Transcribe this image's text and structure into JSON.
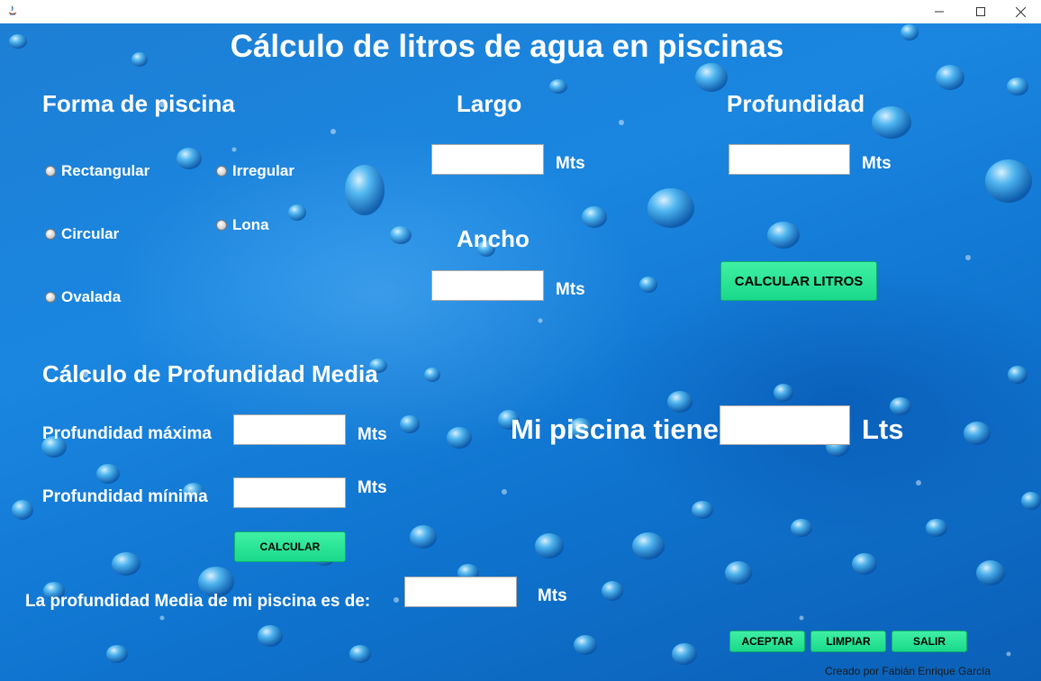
{
  "window": {
    "title": ""
  },
  "header": {
    "title": "Cálculo de litros de agua en piscinas"
  },
  "shape": {
    "heading": "Forma de piscina",
    "options": [
      "Rectangular",
      "Circular",
      "Ovalada",
      "Irregular",
      "Lona"
    ]
  },
  "dimensions": {
    "largo_label": "Largo",
    "ancho_label": "Ancho",
    "profundidad_label": "Profundidad",
    "unit": "Mts",
    "largo_value": "",
    "ancho_value": "",
    "profundidad_value": ""
  },
  "calc_liters_button": "CALCULAR LITROS",
  "result": {
    "label": "Mi piscina tiene",
    "unit": "Lts",
    "value": ""
  },
  "depth_calc": {
    "heading": "Cálculo de Profundidad Media",
    "max_label": "Profundidad máxima",
    "min_label": "Profundidad mínima",
    "unit": "Mts",
    "max_value": "",
    "min_value": "",
    "button": "CALCULAR",
    "result_label": "La profundidad Media de mi piscina es de:",
    "result_value": "",
    "result_unit": "Mts"
  },
  "actions": {
    "accept": "ACEPTAR",
    "clear": "LIMPIAR",
    "exit": "SALIR"
  },
  "footer": {
    "credit": "Creado por Fabián Enrique García"
  },
  "colors": {
    "background": "#1a86e0",
    "button": "#2ee598",
    "text": "#ffffff"
  }
}
